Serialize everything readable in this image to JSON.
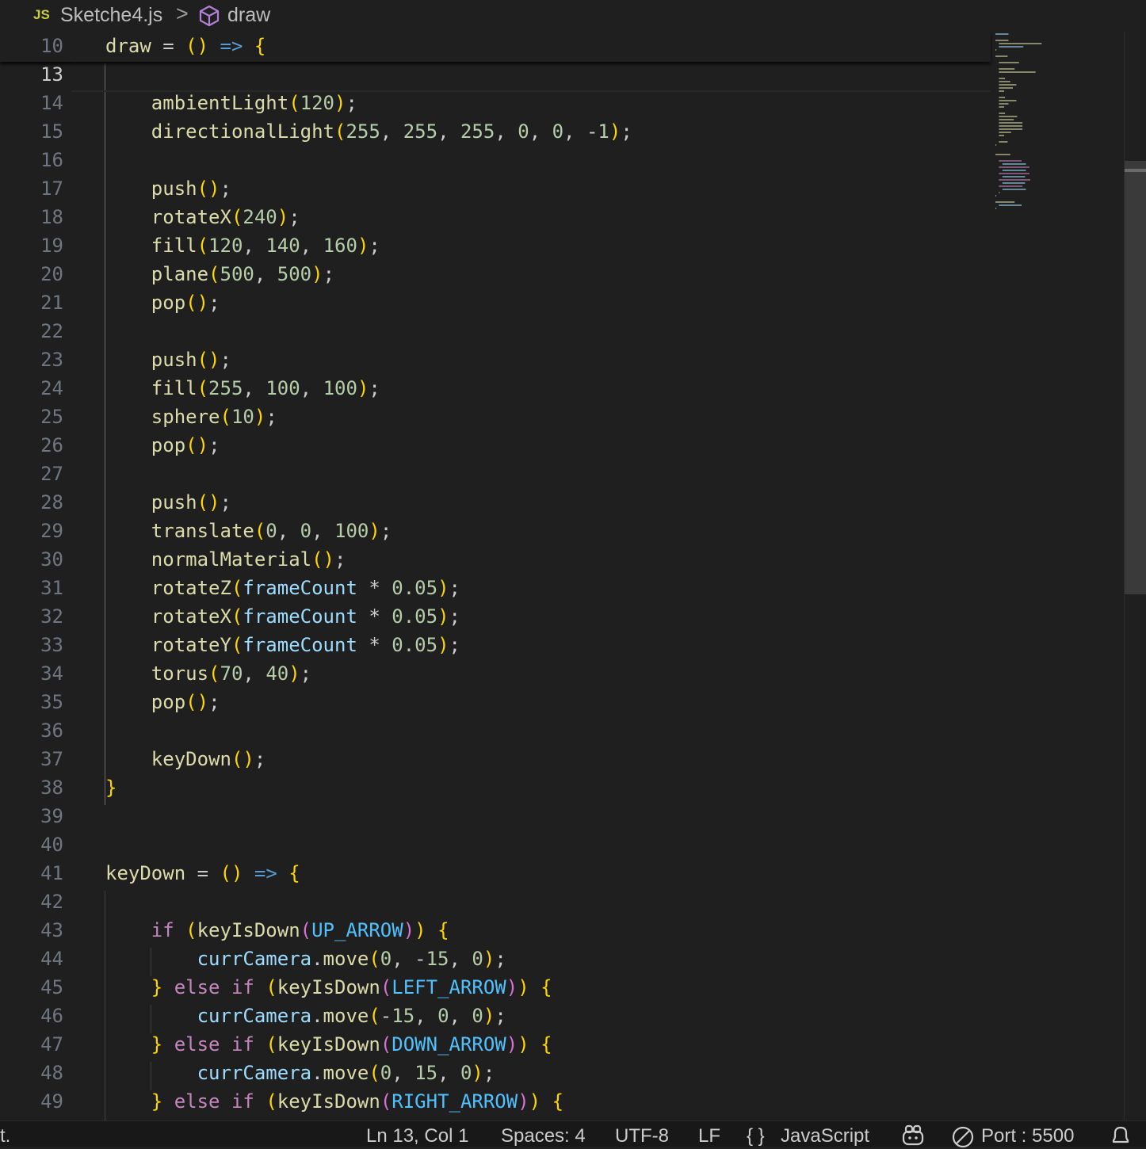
{
  "breadcrumb": {
    "file_icon": "JS",
    "file_name": "Sketche4.js",
    "separator": ">",
    "symbol_icon": "cube-icon",
    "symbol_name": "draw"
  },
  "sticky": {
    "line_number": "10",
    "code": "draw = () => {"
  },
  "lines": [
    {
      "n": "13",
      "code": ""
    },
    {
      "n": "14",
      "code": "    ambientLight(120);"
    },
    {
      "n": "15",
      "code": "    directionalLight(255, 255, 255, 0, 0, -1);"
    },
    {
      "n": "16",
      "code": ""
    },
    {
      "n": "17",
      "code": "    push();"
    },
    {
      "n": "18",
      "code": "    rotateX(240);"
    },
    {
      "n": "19",
      "code": "    fill(120, 140, 160);"
    },
    {
      "n": "20",
      "code": "    plane(500, 500);"
    },
    {
      "n": "21",
      "code": "    pop();"
    },
    {
      "n": "22",
      "code": ""
    },
    {
      "n": "23",
      "code": "    push();"
    },
    {
      "n": "24",
      "code": "    fill(255, 100, 100);"
    },
    {
      "n": "25",
      "code": "    sphere(10);"
    },
    {
      "n": "26",
      "code": "    pop();"
    },
    {
      "n": "27",
      "code": ""
    },
    {
      "n": "28",
      "code": "    push();"
    },
    {
      "n": "29",
      "code": "    translate(0, 0, 100);"
    },
    {
      "n": "30",
      "code": "    normalMaterial();"
    },
    {
      "n": "31",
      "code": "    rotateZ(frameCount * 0.05);"
    },
    {
      "n": "32",
      "code": "    rotateX(frameCount * 0.05);"
    },
    {
      "n": "33",
      "code": "    rotateY(frameCount * 0.05);"
    },
    {
      "n": "34",
      "code": "    torus(70, 40);"
    },
    {
      "n": "35",
      "code": "    pop();"
    },
    {
      "n": "36",
      "code": ""
    },
    {
      "n": "37",
      "code": "    keyDown();"
    },
    {
      "n": "38",
      "code": "}"
    },
    {
      "n": "39",
      "code": ""
    },
    {
      "n": "40",
      "code": ""
    },
    {
      "n": "41",
      "code": "keyDown = () => {"
    },
    {
      "n": "42",
      "code": ""
    },
    {
      "n": "43",
      "code": "    if (keyIsDown(UP_ARROW)) {"
    },
    {
      "n": "44",
      "code": "        currCamera.move(0, -15, 0);"
    },
    {
      "n": "45",
      "code": "    } else if (keyIsDown(LEFT_ARROW)) {"
    },
    {
      "n": "46",
      "code": "        currCamera.move(-15, 0, 0);"
    },
    {
      "n": "47",
      "code": "    } else if (keyIsDown(DOWN_ARROW)) {"
    },
    {
      "n": "48",
      "code": "        currCamera.move(0, 15, 0);"
    },
    {
      "n": "49",
      "code": "    } else if (keyIsDown(RIGHT_ARROW)) {"
    }
  ],
  "active_line": "13",
  "minimap": [
    "let currCamera;",
    "",
    "setup = () => {",
    "    createCanvas(displayWidth, displayHeight, WEBGL);",
    "    currCamera = createCamera();",
    "}",
    "",
    "draw = () => {",
    "",
    "    background(20, 25, 40);",
    "",
    "    ambientLight(120);",
    "    directionalLight(255, 255, 255, 0, 0, -1);",
    "",
    "    push();",
    "    rotateX(240);",
    "    fill(120, 140, 160);",
    "    plane(500, 500);",
    "    pop();",
    "",
    "    push();",
    "    fill(255, 100, 100);",
    "    sphere(10);",
    "    pop();",
    "",
    "    push();",
    "    translate(0, 0, 100);",
    "    normalMaterial();",
    "    rotateZ(frameCount * 0.05);",
    "    rotateX(frameCount * 0.05);",
    "    rotateY(frameCount * 0.05);",
    "    torus(70, 40);",
    "    pop();",
    "",
    "    keyDown();",
    "}",
    "",
    "",
    "keyDown = () => {",
    "",
    "    if (keyIsDown(UP_ARROW)) {",
    "        currCamera.move(0, -15, 0);",
    "    } else if (keyIsDown(LEFT_ARROW)) {",
    "        currCamera.move(-15, 0, 0);",
    "    } else if (keyIsDown(DOWN_ARROW)) {",
    "        currCamera.move(0, 15, 0);",
    "    } else if (keyIsDown(RIGHT_ARROW)) {",
    "        currCamera.move(15, 0, 0);",
    "    } else if (keyIsDown(32)) {",
    "        currCamera.move(0, 0, -15);",
    "    }",
    "}",
    "",
    "mousePressed = () => {",
    "    currCamera.move(0, 0, 10);",
    "}"
  ],
  "statusbar": {
    "left_fragment": "t.",
    "cursor_position": "Ln 13, Col 1",
    "indentation": "Spaces: 4",
    "encoding": "UTF-8",
    "eol": "LF",
    "language_icon": "{ }",
    "language": "JavaScript",
    "copilot_icon": "copilot-icon",
    "port_icon": "no-entry-icon",
    "port": "Port : 5500",
    "bell_icon": "bell-icon"
  },
  "colors": {
    "background": "#1f1f1f",
    "function": "#dcdcaa",
    "number": "#b5cea8",
    "variable": "#9cdcfe",
    "keyword": "#c586c0",
    "operator": "#569cd6",
    "constant": "#4fc1ff",
    "bracket_level1": "#ffd700",
    "bracket_level2": "#da70d6",
    "bracket_level3": "#179fff"
  }
}
